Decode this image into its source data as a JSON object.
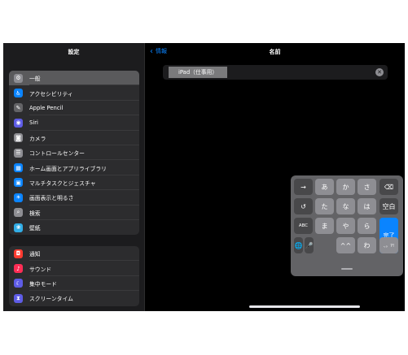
{
  "sidebar": {
    "title": "設定",
    "group1": [
      {
        "label": "一般",
        "icon": "gear-icon",
        "color": "#8e8e93",
        "glyph": "⚙",
        "selected": true
      },
      {
        "label": "アクセシビリティ",
        "icon": "accessibility-icon",
        "color": "#0a84ff",
        "glyph": "♿"
      },
      {
        "label": "Apple Pencil",
        "icon": "pencil-icon",
        "color": "#636366",
        "glyph": "✎"
      },
      {
        "label": "Siri",
        "icon": "siri-icon",
        "color": "#5e5ce6",
        "glyph": "◉"
      },
      {
        "label": "カメラ",
        "icon": "camera-icon",
        "color": "#8e8e93",
        "glyph": "◙"
      },
      {
        "label": "コントロールセンター",
        "icon": "control-center-icon",
        "color": "#8e8e93",
        "glyph": "☰"
      },
      {
        "label": "ホーム画面とアプリライブラリ",
        "icon": "home-screen-icon",
        "color": "#0a84ff",
        "glyph": "▦"
      },
      {
        "label": "マルチタスクとジェスチャ",
        "icon": "multitasking-icon",
        "color": "#0a84ff",
        "glyph": "▣"
      },
      {
        "label": "画面表示と明るさ",
        "icon": "brightness-icon",
        "color": "#0a84ff",
        "glyph": "☀"
      },
      {
        "label": "検索",
        "icon": "search-icon",
        "color": "#8e8e93",
        "glyph": "⌕"
      },
      {
        "label": "壁紙",
        "icon": "wallpaper-icon",
        "color": "#32ade6",
        "glyph": "❀"
      }
    ],
    "group2": [
      {
        "label": "通知",
        "icon": "notifications-icon",
        "color": "#ff3b30",
        "glyph": "◘"
      },
      {
        "label": "サウンド",
        "icon": "sound-icon",
        "color": "#ff2d55",
        "glyph": "♪"
      },
      {
        "label": "集中モード",
        "icon": "focus-moon-icon",
        "color": "#5e5ce6",
        "glyph": "☾"
      },
      {
        "label": "スクリーンタイム",
        "icon": "screen-time-icon",
        "color": "#5e5ce6",
        "glyph": "⧗"
      }
    ]
  },
  "detail": {
    "back_label": "情報",
    "title": "名前",
    "name_value": "iPad（仕事用）"
  },
  "keyboard": {
    "keys": [
      {
        "label": "→",
        "style": "dark",
        "name": "next-candidate-key"
      },
      {
        "label": "あ",
        "style": "light",
        "name": "kana-a-key"
      },
      {
        "label": "か",
        "style": "light",
        "name": "kana-ka-key"
      },
      {
        "label": "さ",
        "style": "light",
        "name": "kana-sa-key"
      },
      {
        "label": "⌫",
        "style": "dark",
        "name": "delete-key"
      },
      {
        "label": "↺",
        "style": "dark",
        "name": "undo-key"
      },
      {
        "label": "た",
        "style": "light",
        "name": "kana-ta-key"
      },
      {
        "label": "な",
        "style": "light",
        "name": "kana-na-key"
      },
      {
        "label": "は",
        "style": "light",
        "name": "kana-ha-key"
      },
      {
        "label": "空白",
        "style": "dark",
        "name": "space-key"
      },
      {
        "label": "ABC",
        "style": "dark",
        "name": "abc-key"
      },
      {
        "label": "ま",
        "style": "light",
        "name": "kana-ma-key"
      },
      {
        "label": "や",
        "style": "light",
        "name": "kana-ya-key"
      },
      {
        "label": "ら",
        "style": "light",
        "name": "kana-ra-key"
      },
      {
        "label": "完了",
        "style": "blue",
        "name": "done-key"
      },
      {
        "label": "🌐",
        "style": "dark",
        "name": "globe-key"
      },
      {
        "label": "🎤",
        "style": "dark",
        "name": "microphone-key"
      },
      {
        "label": "^^",
        "style": "light",
        "name": "emoticon-key"
      },
      {
        "label": "わ",
        "style": "light",
        "name": "kana-wa-key"
      },
      {
        "label": "、。?!",
        "style": "light",
        "name": "punctuation-key"
      }
    ]
  }
}
